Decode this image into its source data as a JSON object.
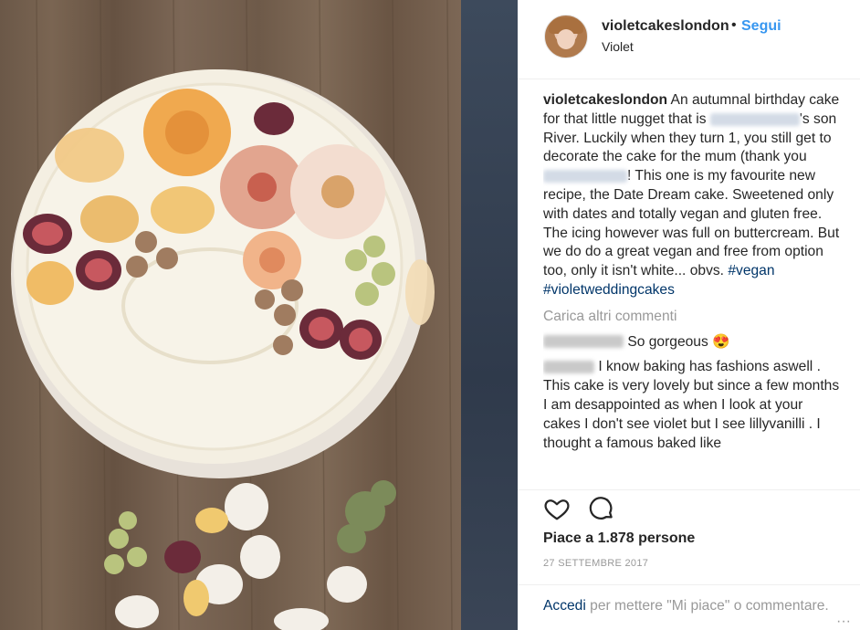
{
  "post": {
    "username": "violetcakeslondon",
    "separator": "•",
    "follow_label": "Segui",
    "location": "Violet",
    "caption": {
      "username": "violetcakeslondon",
      "text_1": "An autumnal birthday cake for that little nugget that is",
      "text_2": "'s son River. Luckily when they turn 1, you still get to decorate the cake for the mum (thank you",
      "text_3": "! This one is my favourite new recipe, the Date Dream cake. Sweetened only with dates and totally vegan and gluten free. The icing however was full on buttercream. But we do do a great vegan and free from option too, only it isn't white... obvs.",
      "hashtag_1": "#vegan",
      "hashtag_2": "#violetweddingcakes"
    },
    "load_more": "Carica altri commenti",
    "comments": [
      {
        "text": "So gorgeous 😍"
      },
      {
        "text": "I know baking has fashions aswell . This cake is very lovely but since a few months I am desappointed as when I look at your cakes I don't see violet but I see lillyvanilli . I thought a famous baked like"
      }
    ],
    "likes": "Piace a 1.878 persone",
    "date": "27 SETTEMBRE 2017",
    "login_link": "Accedi",
    "login_text": "per mettere \"Mi piace\" o commentare.",
    "more": "···"
  },
  "icons": {
    "like": "heart-icon",
    "comment": "comment-icon"
  },
  "colors": {
    "link": "#3897f0",
    "hashtag": "#003569",
    "muted": "#999999"
  }
}
